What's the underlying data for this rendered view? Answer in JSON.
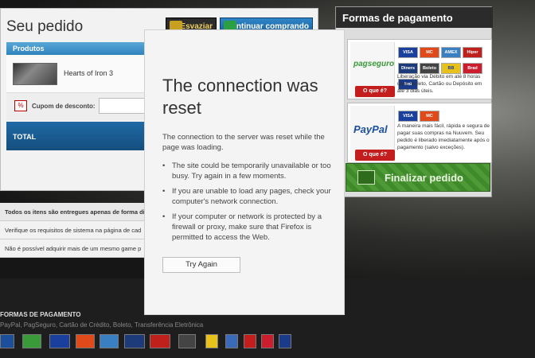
{
  "order": {
    "title": "Seu pedido",
    "empty_label": "Esvaziar",
    "continue_label": "Continuar comprando",
    "products_header": "Produtos",
    "product_name": "Hearts of Iron 3",
    "coupon_label": "Cupom de desconto:",
    "total_label": "TOTAL"
  },
  "notes": [
    "Todos os itens são entregues apenas de forma di",
    "Verifique os requisitos de sistema na página de cad",
    "Não é possível adquirir mais de um mesmo game p"
  ],
  "payment": {
    "title": "Formas de pagamento",
    "pagseguro_logo": "pagseguro",
    "paypal_logo": "PayPal",
    "oque_label_1": "O que é?",
    "oque_label_2": "O que é?",
    "pagseguro_desc": "Liberação via Débito em até 8 horas úteis. Boleto, Cartão ou Depósito em até 3 dias úteis.",
    "paypal_desc": "A maneira mais fácil, rápida e segura de pagar suas compras na Nuuvem. Seu pedido é liberado imediatamente após o pagamento (salvo exceções).",
    "cards_1": [
      "VISA",
      "MC",
      "AMEX",
      "Hiper",
      "Diners",
      "Boleto",
      "BB",
      "Brad",
      "Itaú"
    ],
    "cards_2": [
      "VISA",
      "MC"
    ],
    "finalize_label": "Finalizar pedido"
  },
  "footer": {
    "title": "FORMAS DE PAGAMENTO",
    "methods": "PayPal, PagSeguro, Cartão de Crédito, Boleto, Transferência Eletrônica"
  },
  "error": {
    "title": "The connection was reset",
    "intro": "The connection to the server was reset while the page was loading.",
    "bullets": [
      "The site could be temporarily unavailable or too busy. Try again in a few moments.",
      "If you are unable to load any pages, check your computer's network connection.",
      "If your computer or network is protected by a firewall or proxy, make sure that Firefox is permitted to access the Web."
    ],
    "try_again_label": "Try Again"
  },
  "colors": {
    "products_header": "#2f83bd",
    "total_bar": "#1f6aa6",
    "oque_button": "#c41d1d",
    "finalize_button": "#4f9a36"
  }
}
